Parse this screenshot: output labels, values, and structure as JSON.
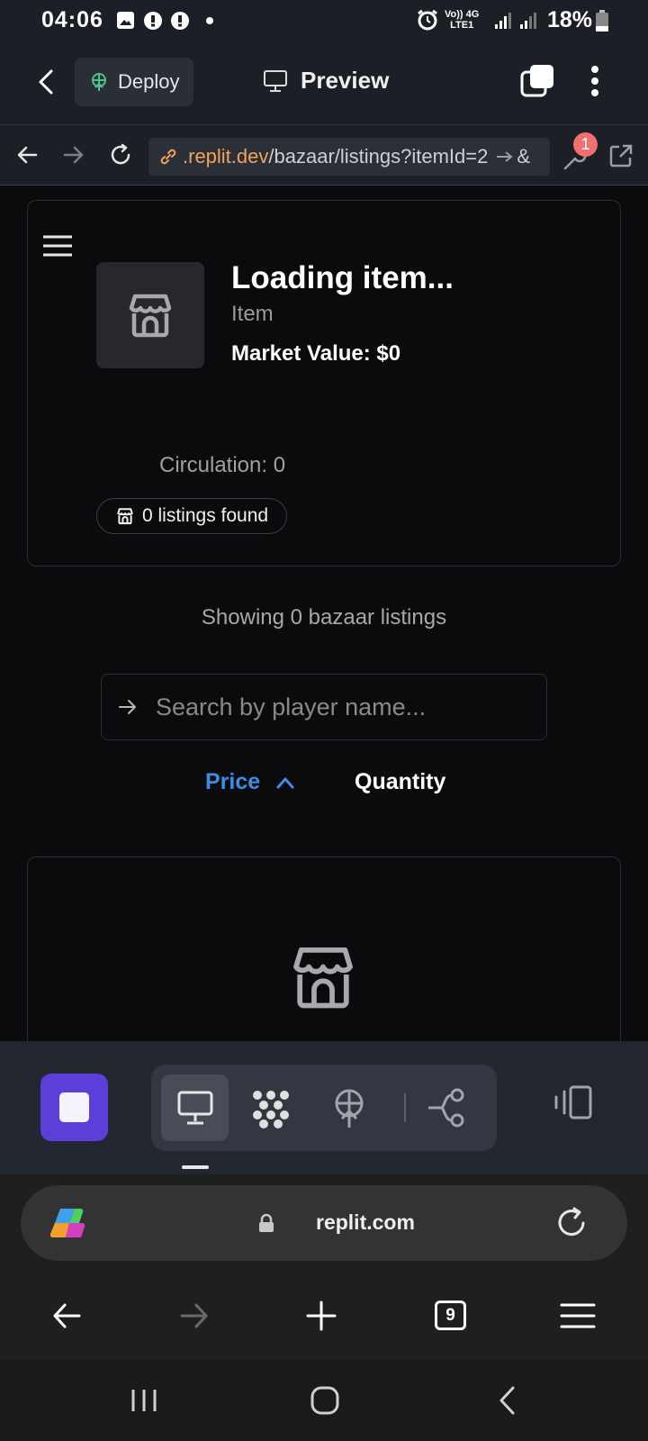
{
  "status_bar": {
    "time": "04:06",
    "battery": "18%",
    "network_label_top": "Vo)) 4G",
    "network_label_bottom": "LTE1"
  },
  "replit_header": {
    "deploy_label": "Deploy",
    "preview_label": "Preview"
  },
  "url_bar": {
    "url_host": ".replit.dev",
    "url_path": "/bazaar/listings?itemId=2",
    "url_tail": "&",
    "devtools_badge": "1"
  },
  "item": {
    "title": "Loading item...",
    "subtitle": "Item",
    "market_value": "Market Value: $0",
    "circulation": "Circulation: 0",
    "listings_found": "0 listings found"
  },
  "listings": {
    "showing_text": "Showing 0 bazaar listings",
    "search_placeholder": "Search by player name...",
    "sort_price": "Price",
    "sort_quantity": "Quantity"
  },
  "browser": {
    "address": "replit.com",
    "tab_count": "9"
  },
  "colors": {
    "accent_blue": "#3b8ee6",
    "stop_purple": "#5b3fd8",
    "url_orange": "#f0a35a",
    "badge_red": "#f07070"
  },
  "icons": [
    "menu-icon",
    "storefront-icon",
    "arrow-right-icon",
    "chevron-up-icon",
    "monitor-icon",
    "packages-icon",
    "deploy-globe-icon",
    "git-branch-icon",
    "devices-icon",
    "refresh-icon",
    "lock-icon",
    "copilot-icon"
  ]
}
